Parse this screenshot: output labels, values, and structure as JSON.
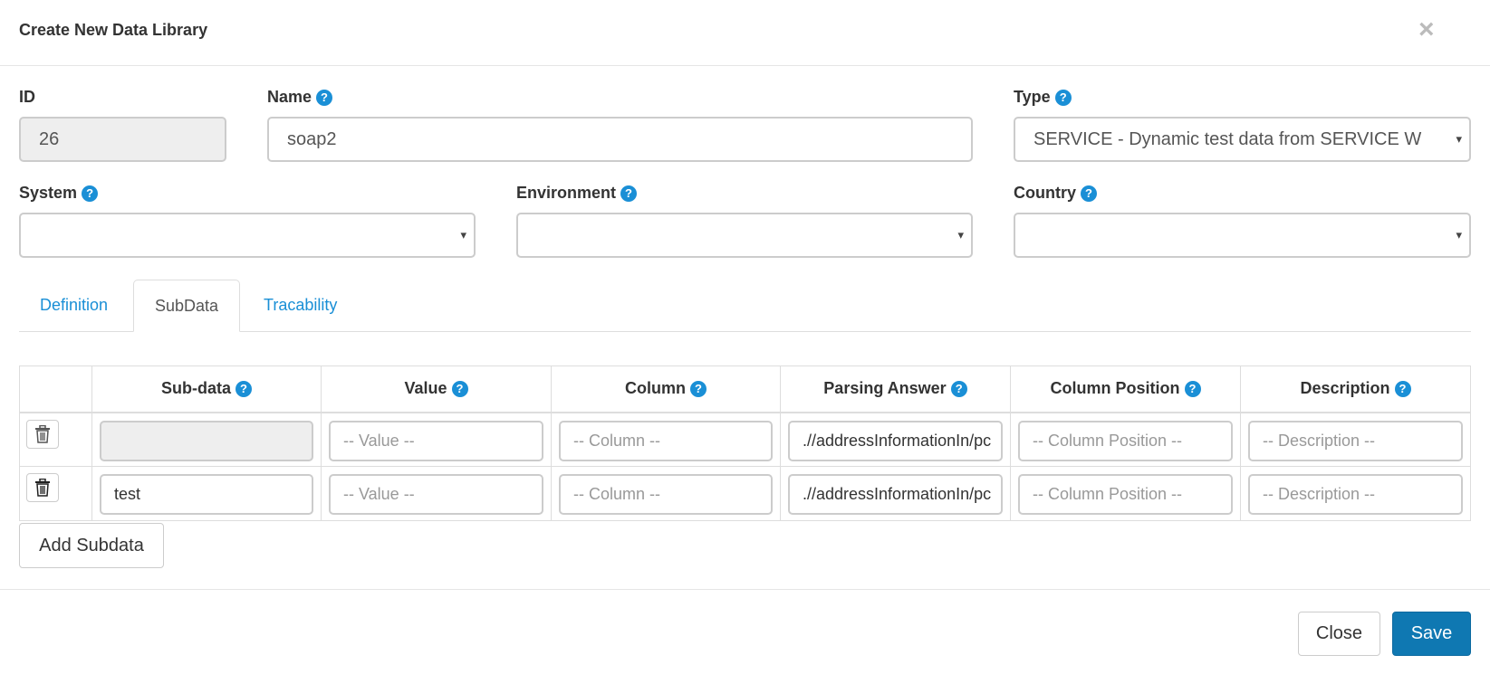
{
  "modal": {
    "title": "Create New Data Library",
    "close_symbol": "×"
  },
  "fields": {
    "id": {
      "label": "ID",
      "value": "26"
    },
    "name": {
      "label": "Name",
      "value": "soap2"
    },
    "type": {
      "label": "Type",
      "value": "SERVICE - Dynamic test data from SERVICE W"
    },
    "system": {
      "label": "System",
      "value": ""
    },
    "environment": {
      "label": "Environment",
      "value": ""
    },
    "country": {
      "label": "Country",
      "value": ""
    }
  },
  "help_symbol": "?",
  "select_caret": "▾",
  "tabs": [
    {
      "label": "Definition",
      "active": false
    },
    {
      "label": "SubData",
      "active": true
    },
    {
      "label": "Tracability",
      "active": false
    }
  ],
  "subdata_table": {
    "headers": [
      "Sub-data",
      "Value",
      "Column",
      "Parsing Answer",
      "Column Position",
      "Description"
    ],
    "placeholders": {
      "value": "-- Value --",
      "column": "-- Column --",
      "column_position": "-- Column Position --",
      "description": "-- Description --"
    },
    "rows": [
      {
        "subdata": "",
        "parsing_answer": ".//addressInformationIn/pc"
      },
      {
        "subdata": "test",
        "parsing_answer": ".//addressInformationIn/pc"
      }
    ]
  },
  "buttons": {
    "add_subdata": "Add Subdata",
    "close": "Close",
    "save": "Save"
  },
  "colors": {
    "link": "#1a8fd6",
    "primary": "#0f78b2",
    "readonly_bg": "#eeeeee"
  },
  "icons": {
    "close": "close-icon",
    "help": "help-icon",
    "delete": "trash-icon",
    "dropdown": "chevron-down-icon"
  }
}
